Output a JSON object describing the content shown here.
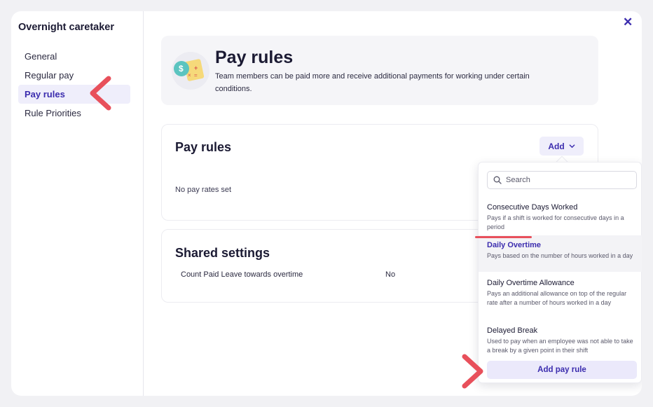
{
  "sidebar": {
    "title": "Overnight caretaker",
    "items": [
      {
        "label": "General"
      },
      {
        "label": "Regular pay"
      },
      {
        "label": "Pay rules"
      },
      {
        "label": "Rule Priorities"
      }
    ],
    "active_index": 2
  },
  "header": {
    "title": "Pay rules",
    "description": "Team members can be paid more and receive additional payments for working under certain conditions."
  },
  "pay_rules_card": {
    "title": "Pay rules",
    "add_label": "Add",
    "empty_text": "No pay rates set"
  },
  "shared_settings": {
    "title": "Shared settings",
    "rows": [
      {
        "label": "Count Paid Leave towards overtime",
        "value": "No"
      }
    ]
  },
  "dropdown": {
    "search_placeholder": "Search",
    "options": [
      {
        "title": "Consecutive Days Worked",
        "description": "Pays if a shift is worked for consecutive days in a period"
      },
      {
        "title": "Daily Overtime",
        "description": "Pays based on the number of hours worked in a day"
      },
      {
        "title": "Daily Overtime Allowance",
        "description": "Pays an additional allowance on top of the regular rate after a number of hours worked in a day"
      },
      {
        "title": "Delayed Break",
        "description": "Used to pay when an employee was not able to take a break by a given point in their shift"
      }
    ],
    "highlighted_index": 1,
    "add_rule_label": "Add pay rule"
  },
  "icons": {
    "close": "close-icon",
    "search": "search-icon",
    "chevron": "chevron-down-icon",
    "header": "pay-rules-illustration-icon",
    "annotation": "annotation-arrow-icon"
  },
  "colors": {
    "accent": "#3b2cae",
    "annotation": "#e8505b",
    "active_bg": "#efeefb"
  }
}
